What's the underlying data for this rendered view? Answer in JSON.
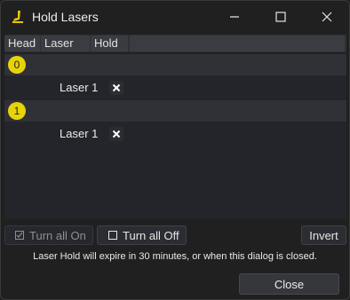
{
  "window": {
    "title": "Hold Lasers",
    "controls": [
      "minimize-icon",
      "maximize-icon",
      "close-icon"
    ]
  },
  "table": {
    "columns": [
      "Head",
      "Laser",
      "Hold"
    ],
    "groups": [
      {
        "head": "0",
        "lasers": [
          {
            "label": "Laser 1",
            "hold": "off"
          }
        ]
      },
      {
        "head": "1",
        "lasers": [
          {
            "label": "Laser 1",
            "hold": "off"
          }
        ]
      }
    ]
  },
  "actions": {
    "turn_all_on": "Turn all On",
    "turn_all_off": "Turn all Off",
    "invert": "Invert",
    "turn_all_on_enabled": false
  },
  "notice": "Laser Hold will expire in 30 minutes, or when this dialog is closed.",
  "close_label": "Close",
  "colors": {
    "background": "#202020",
    "badge": "#e8d30a",
    "header": "#3a3c42"
  }
}
